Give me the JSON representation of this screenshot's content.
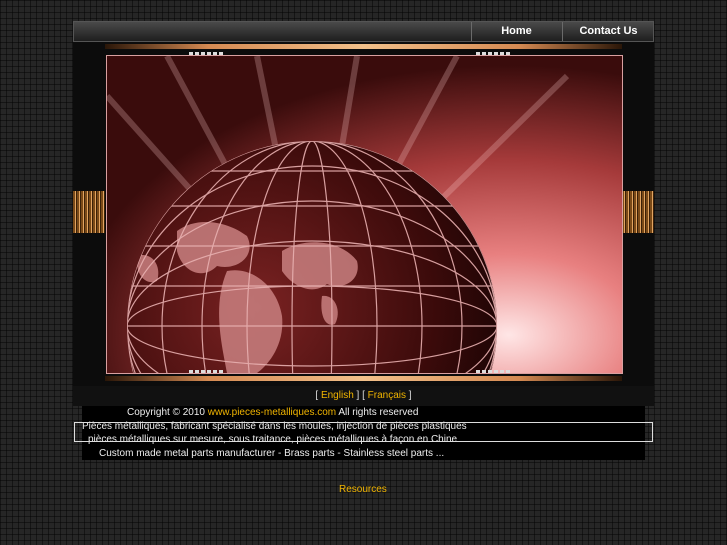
{
  "nav": {
    "home": "Home",
    "contact": "Contact Us"
  },
  "lang": {
    "open": "[ ",
    "english": "English",
    "sep": " ] [ ",
    "french": "Français",
    "close": " ]"
  },
  "footer": {
    "copyright_pre": "Copyright © 2010 ",
    "site_link": "www.pieces-metalliques.com",
    "copyright_post": " All rights reserved",
    "line_fr_1": "Pièces métalliques, fabricant spécialisé dans les moules, injection de pièces plastiques",
    "line_fr_2": "pièces métalliques sur mesure, sous traitance, pièces métalliques à façon en Chine",
    "line_en": "Custom made metal parts manufacturer - Brass parts - Stainless steel parts ..."
  },
  "resources": "Resources"
}
